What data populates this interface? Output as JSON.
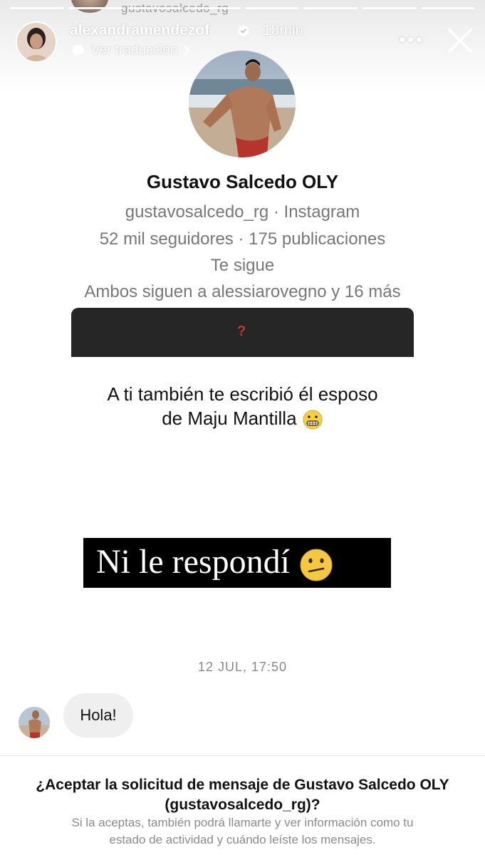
{
  "story": {
    "segments": 8,
    "peek_name": "gustavosalcedo_rg",
    "owner": "alexandramendezof",
    "time": "18min",
    "translate": "Ver traducción",
    "icons": [
      "verified-badge-icon",
      "translate-icon",
      "chevron-right-icon",
      "more-icon",
      "close-icon"
    ]
  },
  "profile": {
    "name": "Gustavo Salcedo OLY",
    "handle_line": "gustavosalcedo_rg · Instagram",
    "stats": "52 mil seguidores · 175 publicaciones",
    "follows_you": "Te sigue",
    "mutual": "Ambos siguen a alessiarovegno y 16 más"
  },
  "overlay": {
    "question_mark": "?",
    "caption_line1": "A ti también te escribió él esposo",
    "caption_line2": "de Maju Mantilla",
    "black_caption": "Ni le respondí"
  },
  "thread": {
    "timestamp": "12 JUL, 17:50",
    "message": "Hola!"
  },
  "request": {
    "title_line1": "¿Aceptar la solicitud de mensaje de Gustavo Salcedo OLY",
    "title_line2": "(gustavosalcedo_rg)?",
    "sub_line1": "Si la aceptas, también podrá llamarte y ver información como tu",
    "sub_line2": "estado de actividad y cuándo leíste los mensajes."
  },
  "colors": {
    "black_bar": "#262626",
    "bubble": "#efefef",
    "muted_text": "#777777",
    "verified": "#ffffff"
  }
}
